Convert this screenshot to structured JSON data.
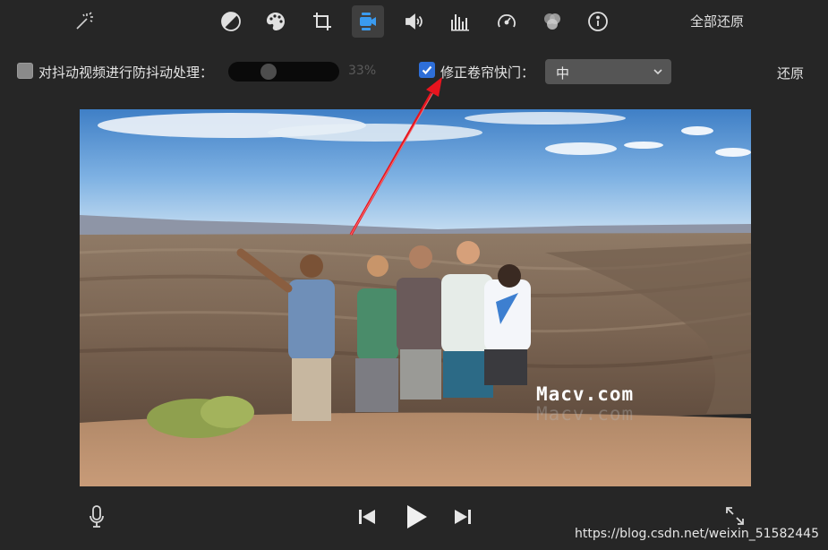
{
  "toolbar": {
    "tools": [
      {
        "icon": "magic-wand-icon"
      },
      {
        "icon": "color-balance-icon"
      },
      {
        "icon": "color-palette-icon"
      },
      {
        "icon": "crop-icon"
      },
      {
        "icon": "stabilization-camera-icon",
        "active": true
      },
      {
        "icon": "volume-icon"
      },
      {
        "icon": "equalizer-icon"
      },
      {
        "icon": "speed-gauge-icon"
      },
      {
        "icon": "clip-filter-icon"
      },
      {
        "icon": "info-icon"
      }
    ],
    "reset_all_label": "全部还原"
  },
  "stabilization": {
    "checked": false,
    "label": "对抖动视频进行防抖动处理：",
    "slider_value_percent": 33,
    "value_label": "33%"
  },
  "rolling_shutter": {
    "checked": true,
    "label": "修正卷帘快门：",
    "selected": "中"
  },
  "reset_label": "还原",
  "viewer": {
    "watermark": "Macv.com",
    "watermark_shadow": "Macv.com"
  },
  "annotation": {
    "arrow_color": "#e8141e"
  },
  "playback": {
    "icons": [
      "microphone-icon",
      "skip-back-icon",
      "play-icon",
      "skip-forward-icon",
      "fullscreen-icon"
    ]
  },
  "credit": "https://blog.csdn.net/weixin_51582445",
  "colors": {
    "accent": "#2e6fd9",
    "background": "#262626"
  }
}
